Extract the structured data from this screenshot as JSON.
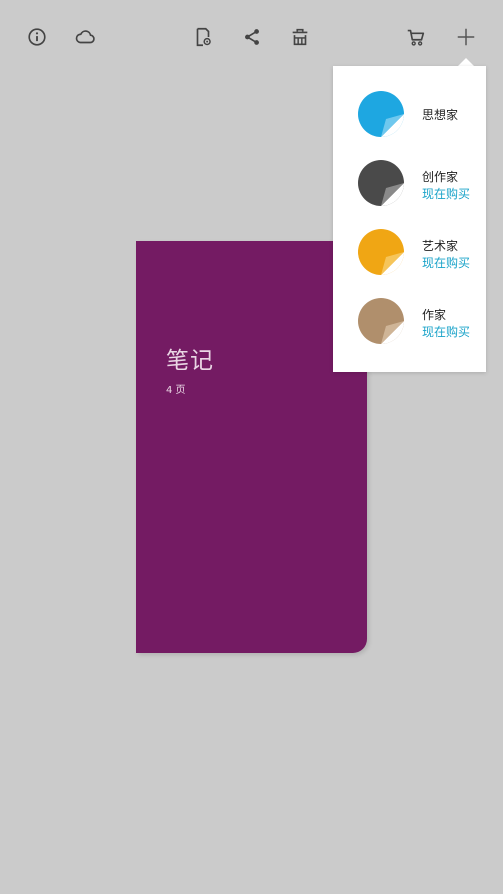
{
  "toolbar": {
    "left": [
      {
        "icon": "info-icon"
      },
      {
        "icon": "cloud-icon"
      }
    ],
    "center": [
      {
        "icon": "page-settings-icon"
      },
      {
        "icon": "share-icon"
      },
      {
        "icon": "delete-icon"
      }
    ],
    "right": [
      {
        "icon": "cart-icon"
      },
      {
        "icon": "plus-icon"
      }
    ]
  },
  "notebook": {
    "title": "笔记",
    "pages": "4 页",
    "color": "#741b63"
  },
  "packs": [
    {
      "name": "思想家",
      "buy": "",
      "color": "#1ea7e1"
    },
    {
      "name": "创作家",
      "buy": "现在购买",
      "color": "#4a4a4a"
    },
    {
      "name": "艺术家",
      "buy": "现在购买",
      "color": "#f0a614"
    },
    {
      "name": "作家",
      "buy": "现在购买",
      "color": "#b08f6c"
    }
  ],
  "colors": {
    "background": "#cbcbcb",
    "accent": "#1aa3c9",
    "icon": "#444444"
  }
}
